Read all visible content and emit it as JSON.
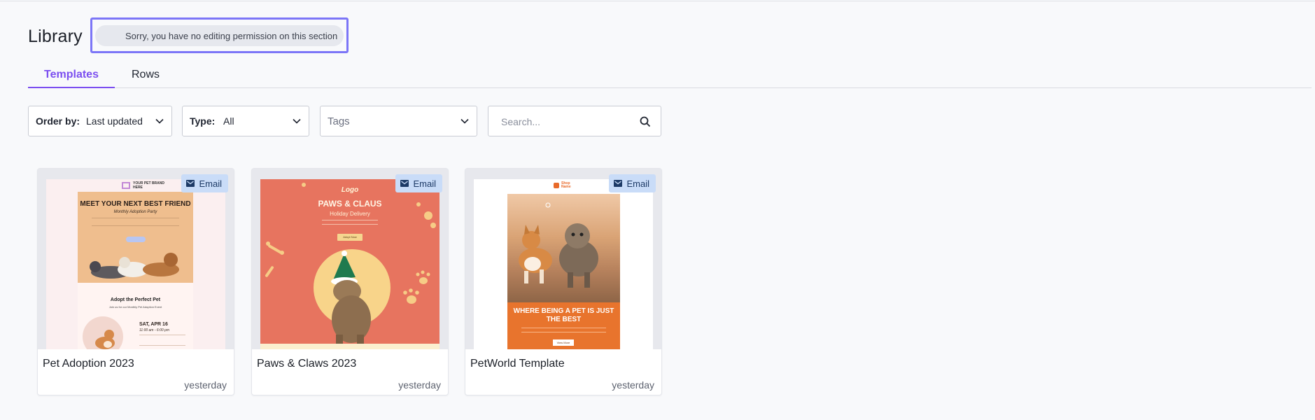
{
  "library": {
    "title": "Library",
    "permission_notice": "Sorry, you have no editing permission on this section"
  },
  "tabs": [
    {
      "label": "Templates",
      "active": true
    },
    {
      "label": "Rows",
      "active": false
    }
  ],
  "filters": {
    "order_by": {
      "label": "Order by:",
      "value": "Last updated"
    },
    "type": {
      "label": "Type:",
      "value": "All"
    },
    "tags": {
      "placeholder": "Tags"
    },
    "search": {
      "placeholder": "Search...",
      "value": ""
    }
  },
  "colors": {
    "accent": "#7b4ef0",
    "notice_border": "#7c76f7",
    "badge_bg": "#c9dcf8"
  },
  "templates": [
    {
      "name": "Pet Adoption 2023",
      "date": "yesterday",
      "badge": "Email",
      "thumbnail": {
        "brand": "YOUR PET BRAND HERE",
        "heading": "MEET YOUR NEXT BEST FRIEND",
        "subheading": "Monthly Adoption Party",
        "section_heading": "Adopt the Perfect Pet",
        "section_sub": "Join us for our Monthly Pet Adoption Event",
        "event_date": "SAT, APR 16",
        "event_time": "11:00 am - 6:00 pm"
      }
    },
    {
      "name": "Paws & Claws 2023",
      "date": "yesterday",
      "badge": "Email",
      "thumbnail": {
        "logo": "Logo",
        "heading": "PAWS & CLAUS",
        "subheading": "Holiday Delivery",
        "button": "Adopt Now"
      }
    },
    {
      "name": "PetWorld Template",
      "date": "yesterday",
      "badge": "Email",
      "thumbnail": {
        "logo": "Shop Name",
        "heading": "WHERE BEING A PET IS JUST THE BEST",
        "button": "View More"
      }
    }
  ],
  "icons": [
    "chevron-down-icon",
    "search-icon",
    "email-icon"
  ]
}
